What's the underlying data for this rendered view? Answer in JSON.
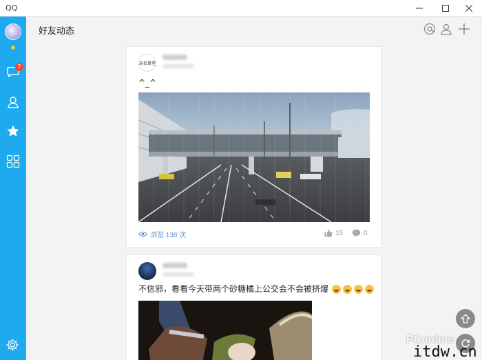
{
  "window": {
    "title": "QQ"
  },
  "sidebar": {
    "unread_badge": "2"
  },
  "header": {
    "title": "好友动态"
  },
  "posts": [
    {
      "avatar_text": "未名草堂",
      "text": "^_^",
      "views_label": "浏览 138 次",
      "likes": "15",
      "comments": "0"
    },
    {
      "text": "不信邪，看看今天带两个砂糖橘上公交会不会被挤爆"
    }
  ],
  "watermark": {
    "brand": "PConline",
    "site": "itdw.cn"
  },
  "colors": {
    "sidebar": "#1daaee",
    "accent": "#5a8fd0",
    "badge": "#f44336"
  }
}
